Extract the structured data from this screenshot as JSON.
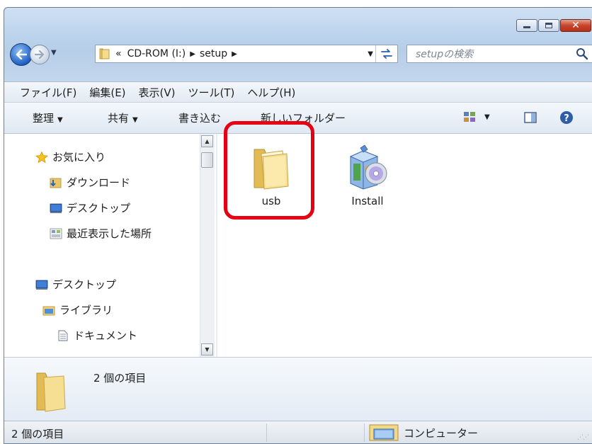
{
  "window": {
    "caption_icons": [
      "minimize-icon",
      "maximize-icon",
      "close-icon"
    ],
    "close_glyph": "✕"
  },
  "nav": {
    "address": {
      "overflow": "«",
      "segment1": "CD-ROM (I:)",
      "segment2": "setup"
    },
    "search_placeholder": "setupの検索"
  },
  "menu": {
    "items": [
      "ファイル(F)",
      "編集(E)",
      "表示(V)",
      "ツール(T)",
      "ヘルプ(H)"
    ]
  },
  "commands": {
    "organize": "整理",
    "share": "共有",
    "burn": "書き込む",
    "new_folder": "新しいフォルダー"
  },
  "sidebar": {
    "items": [
      {
        "label": "お気に入り",
        "icon": "star-icon"
      },
      {
        "label": "ダウンロード",
        "icon": "download-folder-icon"
      },
      {
        "label": "デスクトップ",
        "icon": "desktop-icon"
      },
      {
        "label": "最近表示した場所",
        "icon": "recent-places-icon"
      },
      {
        "label": "デスクトップ",
        "icon": "desktop-icon"
      },
      {
        "label": "ライブラリ",
        "icon": "library-icon"
      },
      {
        "label": "ドキュメント",
        "icon": "document-icon"
      }
    ]
  },
  "files": [
    {
      "name": "usb",
      "icon": "folder-icon",
      "highlighted": true
    },
    {
      "name": "Install",
      "icon": "installer-icon",
      "highlighted": false
    }
  ],
  "details": {
    "count": "2 個の項目"
  },
  "status": {
    "items": "2 個の項目",
    "location": "コンピューター"
  },
  "colors": {
    "highlight": "#e60012",
    "close_button": "#c7432b"
  }
}
